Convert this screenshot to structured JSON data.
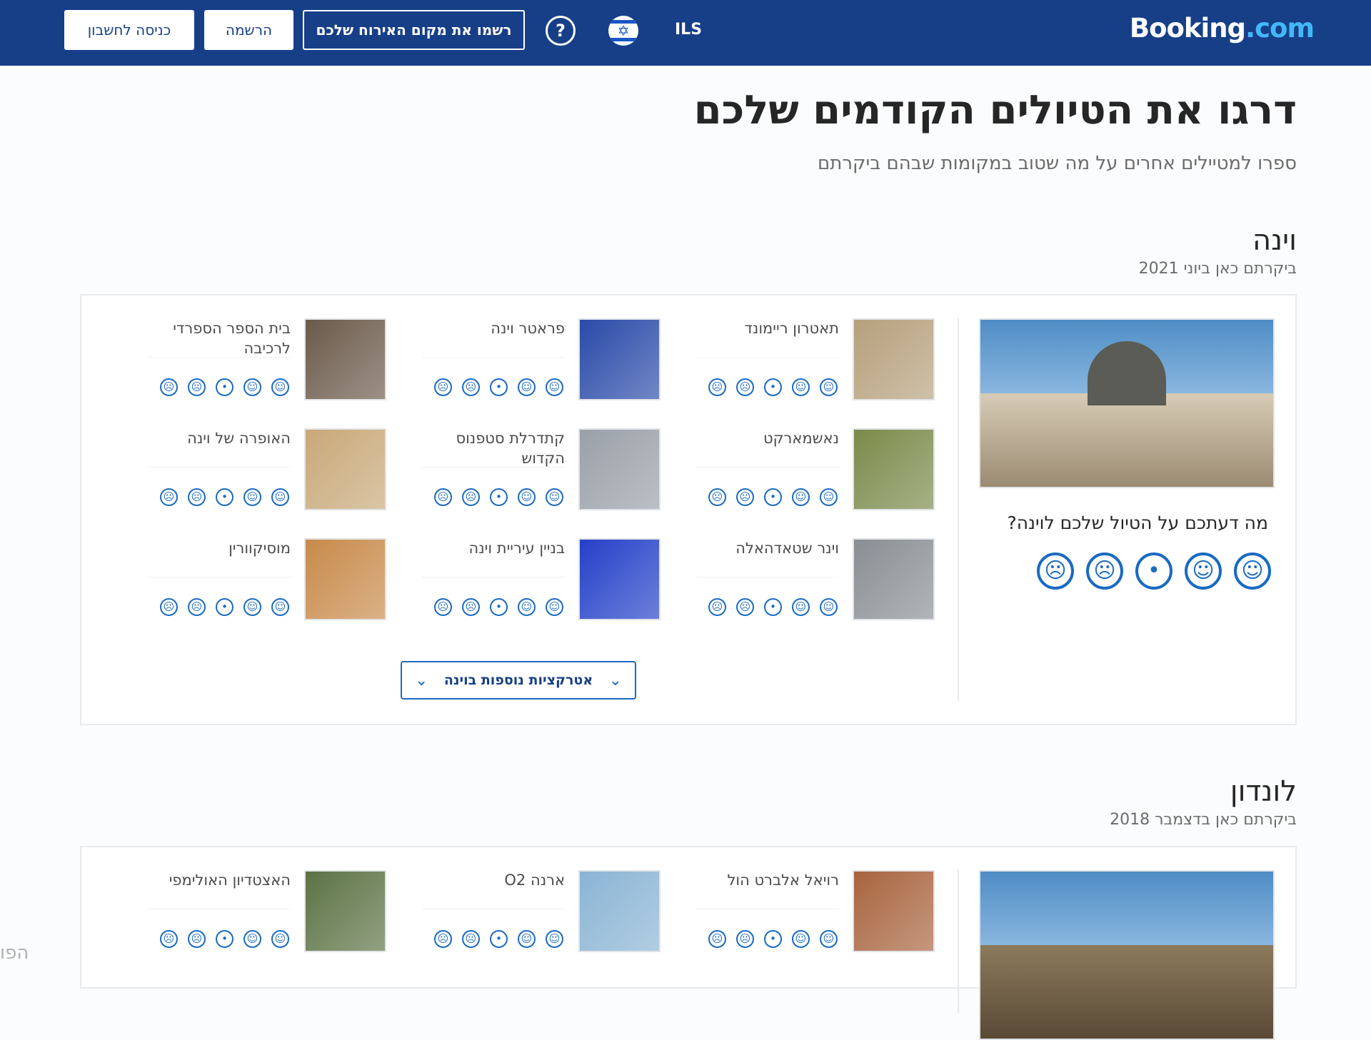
{
  "header": {
    "logo_main": "Booking",
    "logo_dot": ".com",
    "currency": "ILS",
    "help_icon_glyph": "?",
    "list_property": "רשמו את מקום האירוח שלכם",
    "register": "הרשמה",
    "sign_in": "כניסה לחשבון"
  },
  "page": {
    "title": "דרגו את הטיולים הקודמים שלכם",
    "subtitle": "ספרו למטיילים אחרים על מה שטוב במקומות שבהם ביקרתם"
  },
  "cities": [
    {
      "name": "וינה",
      "visited": "ביקרתם כאן ביוני 2021",
      "question": "מה דעתכם על הטיול שלכם לוינה?",
      "attractions": [
        {
          "name": "תאטרון ריימונד",
          "color": "#b6a07c"
        },
        {
          "name": "פראטר וינה",
          "color": "#2a4aa8"
        },
        {
          "name": "בית הספר הספרדי לרכיבה",
          "color": "#6b5a4a"
        },
        {
          "name": "נאשמארקט",
          "color": "#7b8a4a"
        },
        {
          "name": "קתדרלת סטפנוס הקדוש",
          "color": "#9aa0a8"
        },
        {
          "name": "האופרה של וינה",
          "color": "#c8a878"
        },
        {
          "name": "וינר שטאדהאלה",
          "color": "#8a8e94"
        },
        {
          "name": "בניין עיריית וינה",
          "color": "#2440c8"
        },
        {
          "name": "מוסיקוורין",
          "color": "#c88a4a"
        }
      ],
      "more_button": "אטרקציות נוספות בוינה"
    },
    {
      "name": "לונדון",
      "visited": "ביקרתם כאן בדצמבר 2018",
      "attractions": [
        {
          "name": "רויאל אלברט הול",
          "color": "#a8643e"
        },
        {
          "name": "ארנה O2",
          "color": "#8ab4d4"
        },
        {
          "name": "האצטדיון האולימפי",
          "color": "#5c7244"
        }
      ]
    }
  ],
  "faces": {
    "great": "☺",
    "good": "☺",
    "neutral": "•",
    "bad": "☹",
    "awful": "☹"
  },
  "edge_text": "הפו"
}
